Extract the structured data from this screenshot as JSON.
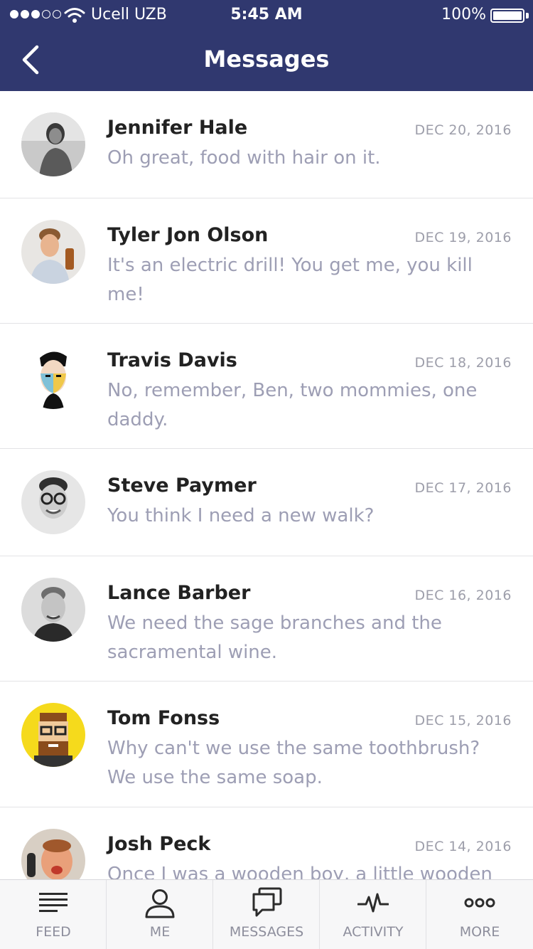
{
  "status_bar": {
    "carrier": "Ucell UZB",
    "time": "5:45 AM",
    "battery": "100%",
    "signal_bars": 3,
    "signal_max": 5
  },
  "header": {
    "title": "Messages",
    "back_icon": "chevron-left-icon"
  },
  "colors": {
    "header_bg": "#30386f",
    "name_text": "#222222",
    "message_text": "#9d9eb4",
    "date_text": "#9d9eaa"
  },
  "messages": [
    {
      "name": "Jennifer Hale",
      "date": "DEC 20, 2016",
      "text": "Oh great, food with hair on it."
    },
    {
      "name": "Tyler Jon Olson",
      "date": "DEC 19, 2016",
      "text": "It's an electric drill! You get me, you kill me!"
    },
    {
      "name": "Travis Davis",
      "date": "DEC 18, 2016",
      "text": "No, remember, Ben, two mommies, one daddy."
    },
    {
      "name": "Steve Paymer",
      "date": "DEC 17, 2016",
      "text": "You think I need a new walk?"
    },
    {
      "name": "Lance Barber",
      "date": "DEC 16, 2016",
      "text": "We need the sage branches and the sacramental wine."
    },
    {
      "name": "Tom Fonss",
      "date": "DEC 15, 2016",
      "text": "Why can't we use the same toothbrush? We use the same soap."
    },
    {
      "name": "Josh Peck",
      "date": "DEC 14, 2016",
      "text": "Once I was a wooden boy, a little wooden"
    }
  ],
  "tabbar": {
    "tabs": [
      {
        "label": "FEED",
        "icon": "lines-icon"
      },
      {
        "label": "ME",
        "icon": "person-icon"
      },
      {
        "label": "MESSAGES",
        "icon": "chat-icon"
      },
      {
        "label": "ACTIVITY",
        "icon": "pulse-icon"
      },
      {
        "label": "MORE",
        "icon": "more-dots-icon"
      }
    ]
  }
}
